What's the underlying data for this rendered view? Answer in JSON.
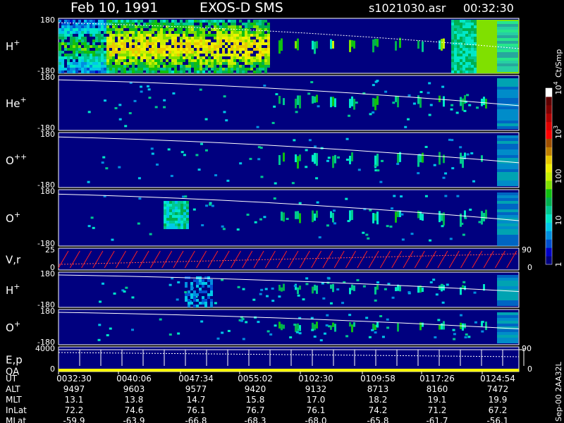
{
  "header": {
    "date": "Feb 10, 1991",
    "mission": "EXOS-D SMS",
    "file": "s1021030.asr",
    "time": "00:32:30"
  },
  "colorbar": {
    "unit_label": "Ct/Smp",
    "tick_labels": [
      "1",
      "10",
      "100",
      "10",
      "10"
    ],
    "tick_exponents": [
      "",
      "",
      "",
      "3",
      "4"
    ],
    "colors": [
      "#00007f",
      "#0000c8",
      "#0050d0",
      "#0090e0",
      "#00c8e8",
      "#00e8c8",
      "#00c890",
      "#00b050",
      "#10c010",
      "#80e000",
      "#c8f000",
      "#f0f000",
      "#e8c800",
      "#c08000",
      "#a05000",
      "#ff0000",
      "#e00000",
      "#b00000",
      "#800000",
      "#600000",
      "#ffffff"
    ]
  },
  "footer": {
    "side_label": "Sep-00  2AA32L"
  },
  "chart_data": {
    "type": "heatmap",
    "time_axis": {
      "label": "UT",
      "ticks": [
        "0032:30",
        "0040:06",
        "0047:34",
        "0055:02",
        "0102:30",
        "0109:58",
        "0117:26",
        "0124:54"
      ]
    },
    "ephemeris": [
      {
        "name": "ALT",
        "values": [
          "9497",
          "9603",
          "9577",
          "9420",
          "9132",
          "8713",
          "8160",
          "7472"
        ]
      },
      {
        "name": "MLT",
        "values": [
          "13.1",
          "13.8",
          "14.7",
          "15.8",
          "17.0",
          "18.2",
          "19.1",
          "19.9"
        ]
      },
      {
        "name": "InLat",
        "values": [
          "72.2",
          "74.6",
          "76.1",
          "76.7",
          "76.1",
          "74.2",
          "71.2",
          "67.2"
        ]
      },
      {
        "name": "MLat",
        "values": [
          "-59.9",
          "-63.9",
          "-66.8",
          "-68.3",
          "-68.0",
          "-65.8",
          "-61.7",
          "-56.1"
        ]
      }
    ],
    "panels": [
      {
        "label": "H",
        "sup": "+",
        "ymax": "180",
        "ymin": "-180",
        "type": "heatmap"
      },
      {
        "label": "He",
        "sup": "+",
        "ymax": "180",
        "ymin": "-180",
        "type": "heatmap"
      },
      {
        "label": "O",
        "sup": "++",
        "ymax": "180",
        "ymin": "-180",
        "type": "heatmap"
      },
      {
        "label": "O",
        "sup": "+",
        "ymax": "180",
        "ymin": "-180",
        "type": "heatmap"
      },
      {
        "label": "V,r",
        "sup": "",
        "ymax": "25",
        "ymin": "0",
        "right_max": "90",
        "right_min": "0",
        "type": "line"
      },
      {
        "label": "H",
        "sup": "+",
        "ymax": "180",
        "ymin": "-180",
        "type": "heatmap"
      },
      {
        "label": "O",
        "sup": "+",
        "ymax": "180",
        "ymin": "-180",
        "type": "heatmap"
      },
      {
        "label": "E,p",
        "label2": "QA",
        "sup": "",
        "ymax": "4000",
        "ymin": "0",
        "right_max": "90",
        "right_min": "0",
        "type": "line"
      }
    ]
  }
}
